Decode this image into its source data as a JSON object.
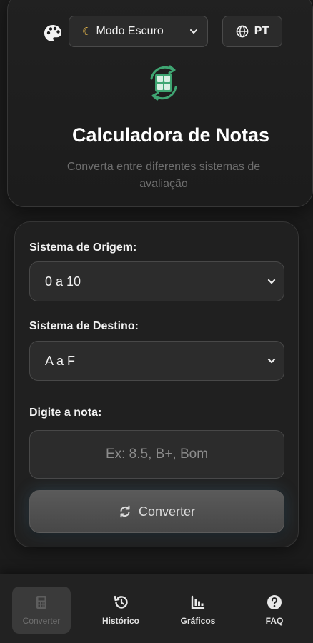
{
  "header": {
    "palette_icon": "palette-icon",
    "theme_select": {
      "icon": "moon-icon",
      "value": "Modo Escuro"
    },
    "language_button": {
      "icon": "globe-icon",
      "label": "PT"
    },
    "logo_icon": "calculator-sync-icon",
    "title": "Calculadora de Notas",
    "subtitle": "Converta entre diferentes sistemas de avaliação"
  },
  "form": {
    "source_label": "Sistema de Origem:",
    "source_value": "0 a 10",
    "target_label": "Sistema de Destino:",
    "target_value": "A a F",
    "grade_label": "Digite a nota:",
    "grade_placeholder": "Ex: 8.5, B+, Bom",
    "grade_value": "",
    "convert_label": "Converter",
    "convert_icon": "sync-icon"
  },
  "nav": {
    "items": [
      {
        "label": "Converter",
        "icon": "calculator-icon",
        "active": true
      },
      {
        "label": "Histórico",
        "icon": "history-icon",
        "active": false
      },
      {
        "label": "Gráficos",
        "icon": "chart-icon",
        "active": false
      },
      {
        "label": "FAQ",
        "icon": "question-icon",
        "active": false
      }
    ]
  },
  "colors": {
    "background": "#1b1b1b",
    "card": "#202020",
    "accent_green": "#3fa572",
    "moon_yellow": "#f2c14e"
  }
}
